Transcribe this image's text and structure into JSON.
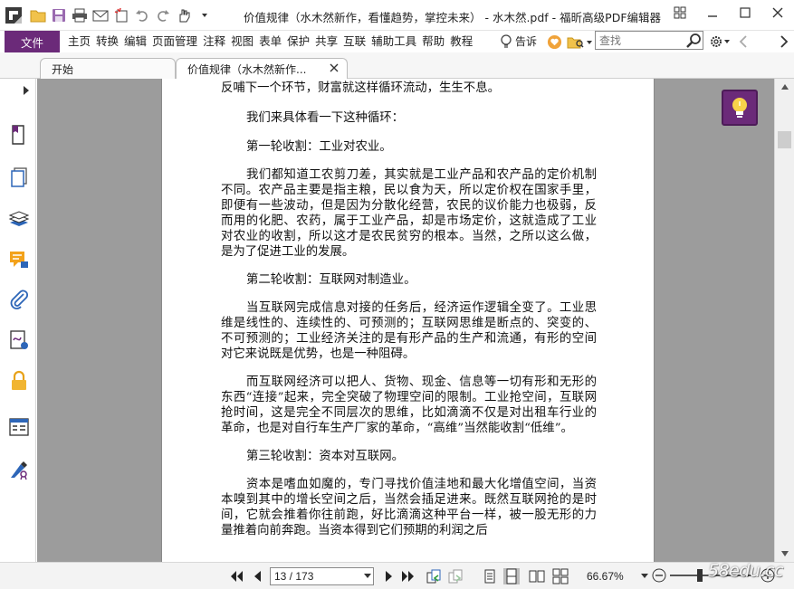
{
  "window": {
    "title": "价值规律（水木然新作，看懂趋势，掌控未来） - 水木然.pdf - 福昕高级PDF编辑器"
  },
  "menu": {
    "file": "文件",
    "items": [
      "主页",
      "转换",
      "编辑",
      "页面管理",
      "注释",
      "视图",
      "表单",
      "保护",
      "共享",
      "互联",
      "辅助工具",
      "帮助",
      "教程"
    ],
    "tell_me": "告诉",
    "search_placeholder": "查找"
  },
  "tabs": [
    {
      "label": "开始"
    },
    {
      "label": "价值规律（水木然新作..."
    }
  ],
  "document": {
    "paragraphs": [
      {
        "text": "反哺下一个环节，财富就这样循环流动，生生不息。",
        "kind": "cont"
      },
      {
        "text": "我们来具体看一下这种循环：",
        "kind": "heading"
      },
      {
        "text": "第一轮收割：工业对农业。",
        "kind": "heading"
      },
      {
        "text": "我们都知道工农剪刀差，其实就是工业产品和农产品的定价机制不同。农产品主要是指主粮，民以食为天，所以定价权在国家手里，即便有一些波动，但是因为分散化经营，农民的议价能力也极弱，反而用的化肥、农药，属于工业产品，却是市场定价，这就造成了工业对农业的收割，所以这才是农民贫穷的根本。当然，之所以这么做，是为了促进工业的发展。",
        "kind": "body"
      },
      {
        "text": "第二轮收割：互联网对制造业。",
        "kind": "heading"
      },
      {
        "text": "当互联网完成信息对接的任务后，经济运作逻辑全变了。工业思维是线性的、连续性的、可预测的；互联网思维是断点的、突变的、不可预测的；工业经济关注的是有形产品的生产和流通，有形的空间对它来说既是优势，也是一种阻碍。",
        "kind": "body"
      },
      {
        "text": "而互联网经济可以把人、货物、现金、信息等一切有形和无形的东西“连接”起来，完全突破了物理空间的限制。工业抢空间，互联网抢时间，这是完全不同层次的思维，比如滴滴不仅是对出租车行业的革命，也是对自行车生产厂家的革命，“高维”当然能收割“低维”。",
        "kind": "body"
      },
      {
        "text": "第三轮收割：资本对互联网。",
        "kind": "heading"
      },
      {
        "text": "资本是嗜血如魔的，专门寻找价值洼地和最大化增值空间，当资本嗅到其中的增长空间之后，当然会插足进来。既然互联网抢的是时间，它就会推着你往前跑，好比滴滴这种平台一样，被一股无形的力量推着向前奔跑。当资本得到它们预期的利润之后",
        "kind": "body"
      }
    ]
  },
  "status": {
    "page_indicator": "13 / 173",
    "zoom": "66.67%"
  },
  "watermark": "58edu.cc",
  "colors": {
    "accent": "#6b2a79",
    "viewport_bg": "#9c9c9c"
  },
  "icons": {
    "left_toolbar": [
      "bookmark-icon",
      "page-thumbnails-icon",
      "layers-icon",
      "comments-icon",
      "attachments-icon",
      "signature-icon",
      "security-icon",
      "form-fields-icon",
      "sign-tool-icon"
    ]
  }
}
